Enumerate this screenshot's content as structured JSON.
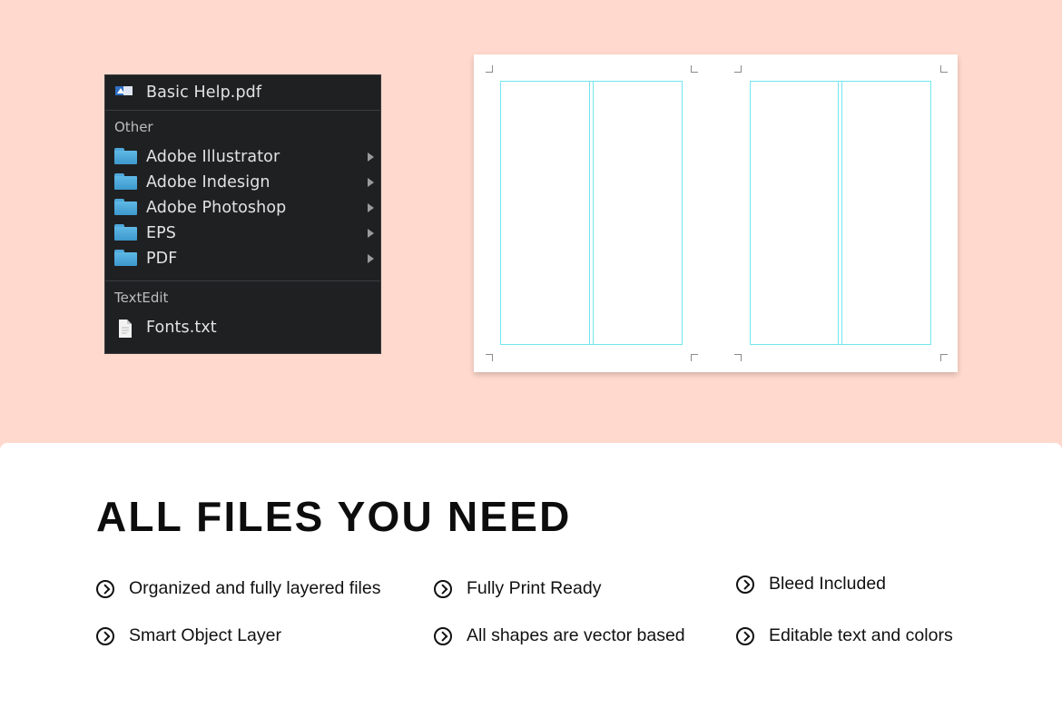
{
  "menu": {
    "top_item": {
      "label": "Basic Help.pdf",
      "icon": "pdf-file-icon"
    },
    "section_other": "Other",
    "folders": [
      {
        "label": "Adobe Illustrator",
        "icon": "folder-icon"
      },
      {
        "label": "Adobe Indesign",
        "icon": "folder-icon"
      },
      {
        "label": "Adobe Photoshop",
        "icon": "folder-icon"
      },
      {
        "label": "EPS",
        "icon": "folder-icon"
      },
      {
        "label": "PDF",
        "icon": "folder-icon"
      }
    ],
    "section_textedit": "TextEdit",
    "bottom_item": {
      "label": "Fonts.txt",
      "icon": "text-file-icon"
    }
  },
  "card": {
    "title": "ALL FILES YOU NEED",
    "features": [
      "Organized and fully layered files",
      "Fully Print Ready",
      "Bleed Included",
      "Smart Object Layer",
      "All shapes are vector based",
      "Editable text and colors"
    ]
  },
  "colors": {
    "background": "#ffd9cd",
    "menu_bg": "#1f2022",
    "folder_blue": "#4ea8d8",
    "guide_cyan": "#73e6ef"
  }
}
